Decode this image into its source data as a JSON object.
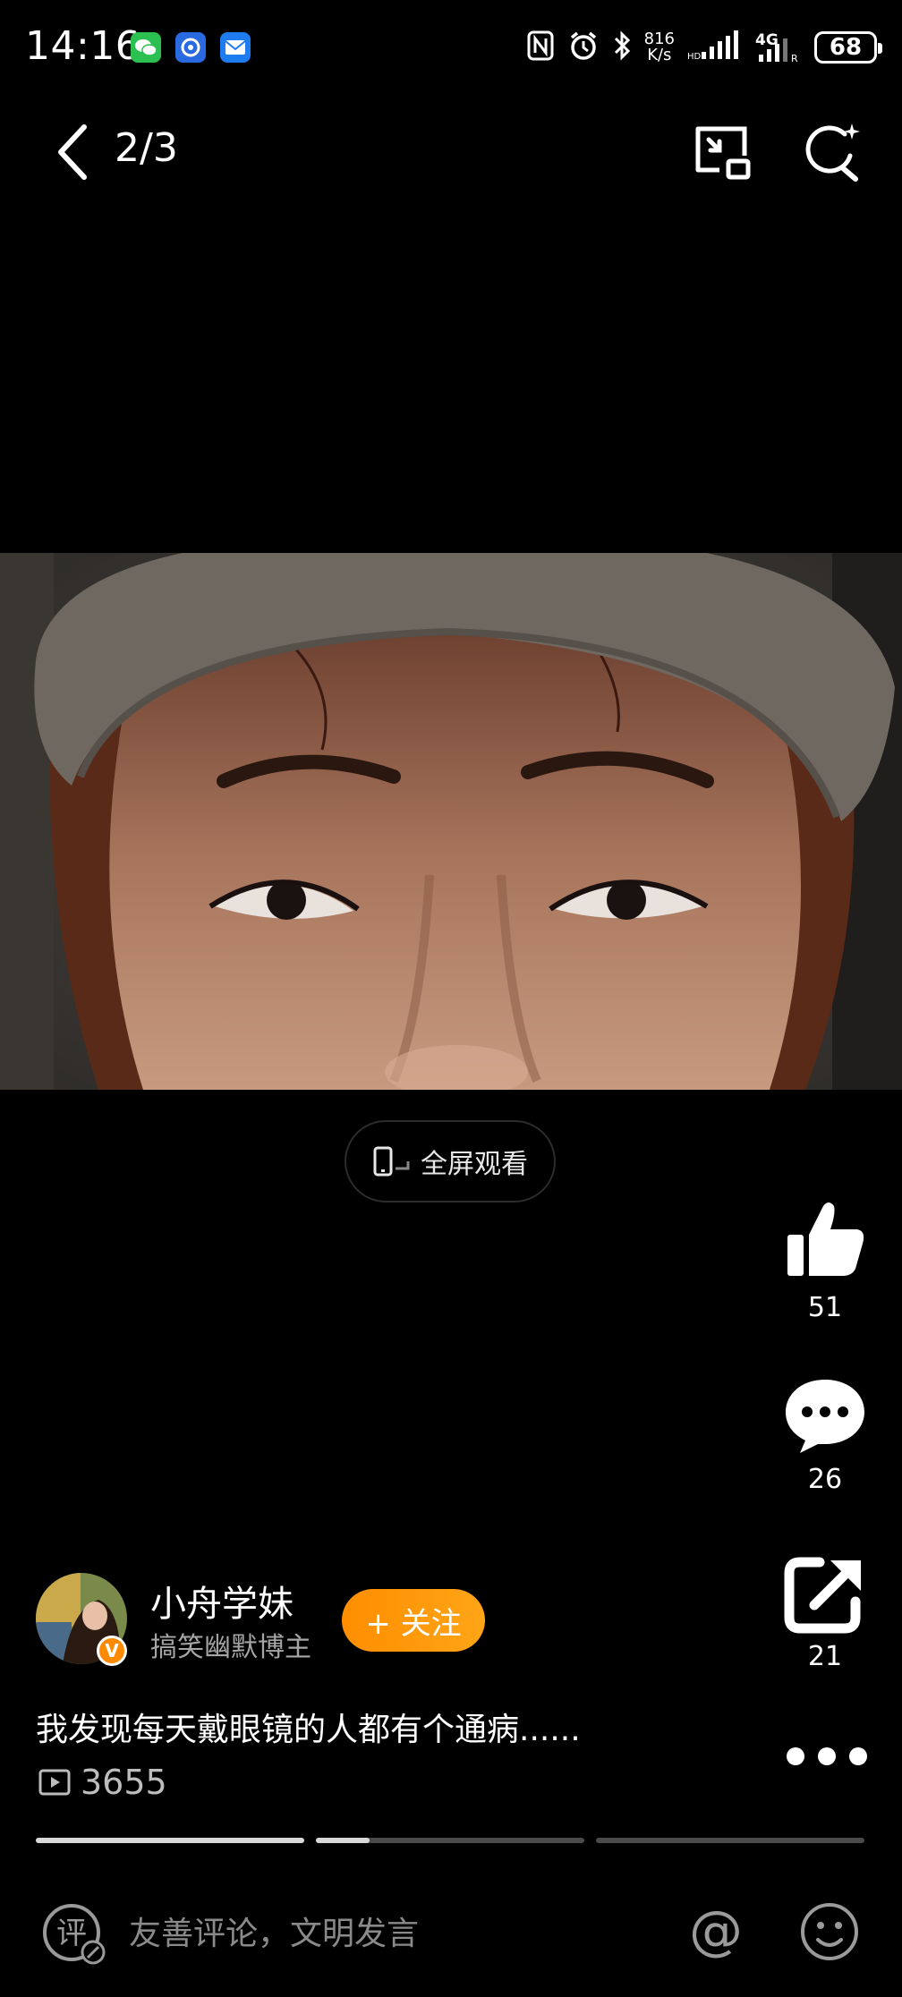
{
  "status_bar": {
    "time": "14:16",
    "net_speed_value": "816",
    "net_speed_unit": "K/s",
    "network": "4G",
    "battery": "68",
    "app_icons": [
      "wechat-icon",
      "blue-app-icon",
      "mail-icon"
    ]
  },
  "nav": {
    "page_counter": "2/3"
  },
  "fullscreen": {
    "label": "全屏观看"
  },
  "actions": {
    "likes": "51",
    "comments": "26",
    "shares": "21"
  },
  "author": {
    "name": "小舟学妹",
    "description": "搞笑幽默博主",
    "follow_label": "+ 关注",
    "verified_badge": "V"
  },
  "post": {
    "caption": "我发现每天戴眼镜的人都有个通病......",
    "views": "3655"
  },
  "progress": {
    "segments": 3,
    "current_segment": 2,
    "current_fill": 0.2
  },
  "bottom_bar": {
    "comment_icon_text": "评",
    "comment_placeholder": "友善评论，文明发言",
    "at_symbol": "@"
  },
  "colors": {
    "accent": "#ff9500",
    "background": "#000000"
  }
}
